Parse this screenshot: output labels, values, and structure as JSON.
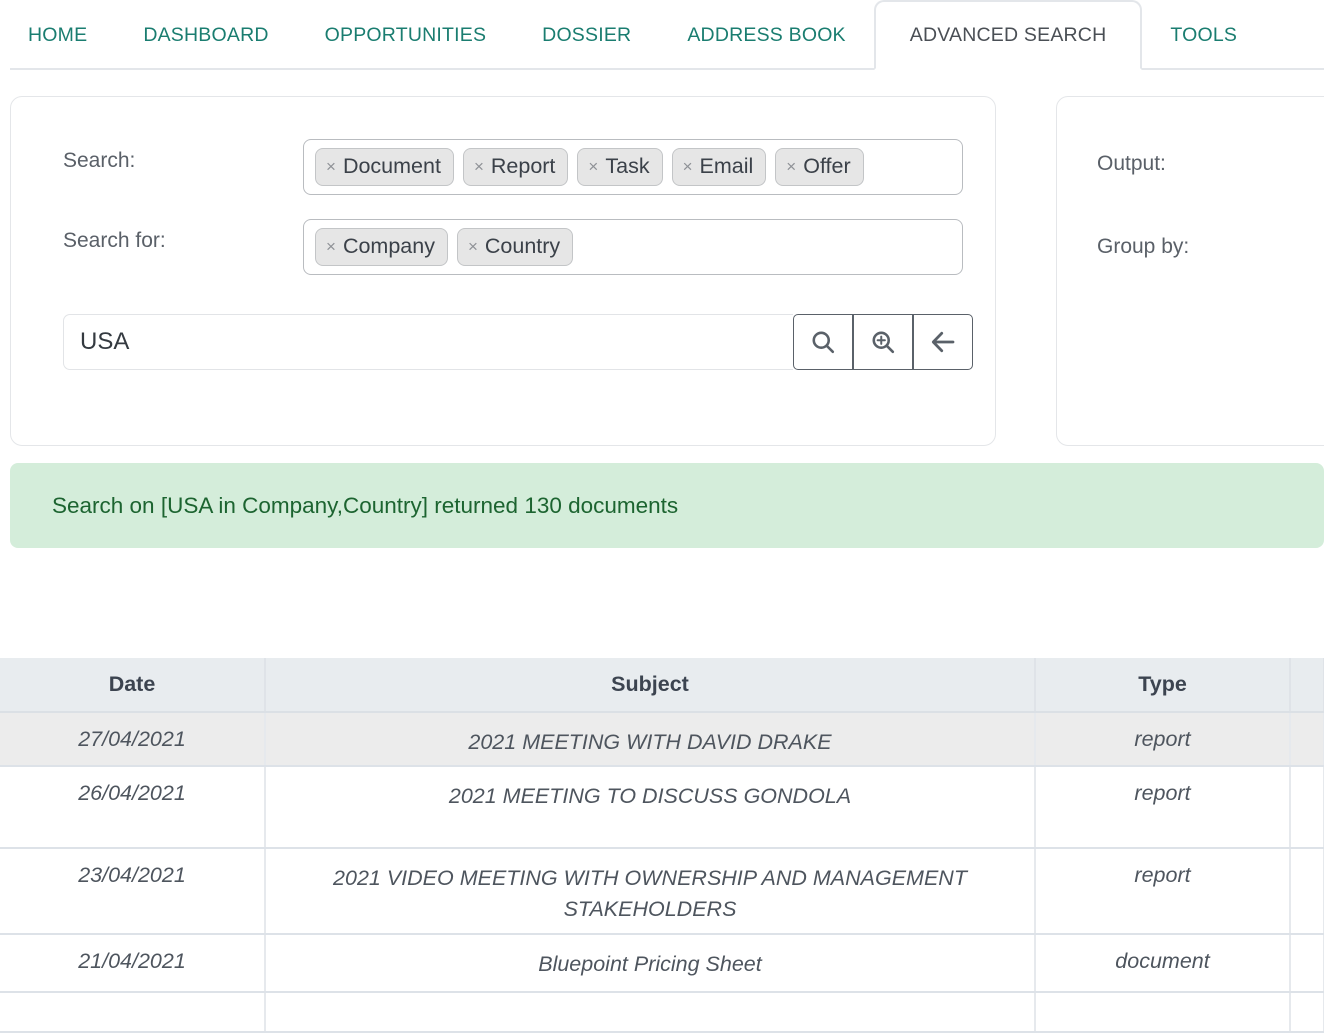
{
  "nav": {
    "tabs": [
      {
        "label": "HOME",
        "active": false
      },
      {
        "label": "DASHBOARD",
        "active": false
      },
      {
        "label": "OPPORTUNITIES",
        "active": false
      },
      {
        "label": "DOSSIER",
        "active": false
      },
      {
        "label": "ADDRESS BOOK",
        "active": false
      },
      {
        "label": "ADVANCED SEARCH",
        "active": true
      },
      {
        "label": "TOOLS",
        "active": false
      }
    ]
  },
  "search_panel": {
    "search_label": "Search:",
    "search_for_label": "Search for:",
    "search_chips": [
      {
        "remove": "×",
        "label": "Document"
      },
      {
        "remove": "×",
        "label": "Report"
      },
      {
        "remove": "×",
        "label": "Task"
      },
      {
        "remove": "×",
        "label": "Email"
      },
      {
        "remove": "×",
        "label": "Offer"
      }
    ],
    "search_for_chips": [
      {
        "remove": "×",
        "label": "Company"
      },
      {
        "remove": "×",
        "label": "Country"
      }
    ],
    "query_value": "USA",
    "query_placeholder": "",
    "buttons": [
      {
        "icon": "search-icon",
        "title": "Search"
      },
      {
        "icon": "search-plus-icon",
        "title": "Advanced search"
      },
      {
        "icon": "arrow-left-icon",
        "title": "Back"
      }
    ]
  },
  "output_panel": {
    "output_label": "Output:",
    "group_by_label": "Group by:"
  },
  "alert": {
    "message": "Search on [USA in Company,Country] returned 130 documents",
    "background_color": "#d4edda",
    "text_color": "#1c6430"
  },
  "results_table": {
    "columns": [
      "Date",
      "Subject",
      "Type",
      ""
    ],
    "rows": [
      {
        "date": "27/04/2021",
        "subject": "2021 MEETING WITH DAVID DRAKE",
        "type": "report",
        "extra": ""
      },
      {
        "date": "26/04/2021",
        "subject": "2021 MEETING TO DISCUSS GONDOLA",
        "type": "report",
        "extra": ""
      },
      {
        "date": "23/04/2021",
        "subject": "2021 VIDEO MEETING WITH OWNERSHIP AND MANAGEMENT STAKEHOLDERS",
        "type": "report",
        "extra": ""
      },
      {
        "date": "21/04/2021",
        "subject": "Bluepoint Pricing Sheet",
        "type": "document",
        "extra": ""
      }
    ]
  },
  "colors": {
    "brand_teal": "#1a7d70",
    "link_teal": "#11705f",
    "header_bg": "#e8ecef",
    "alt_row_bg": "#ececec"
  }
}
